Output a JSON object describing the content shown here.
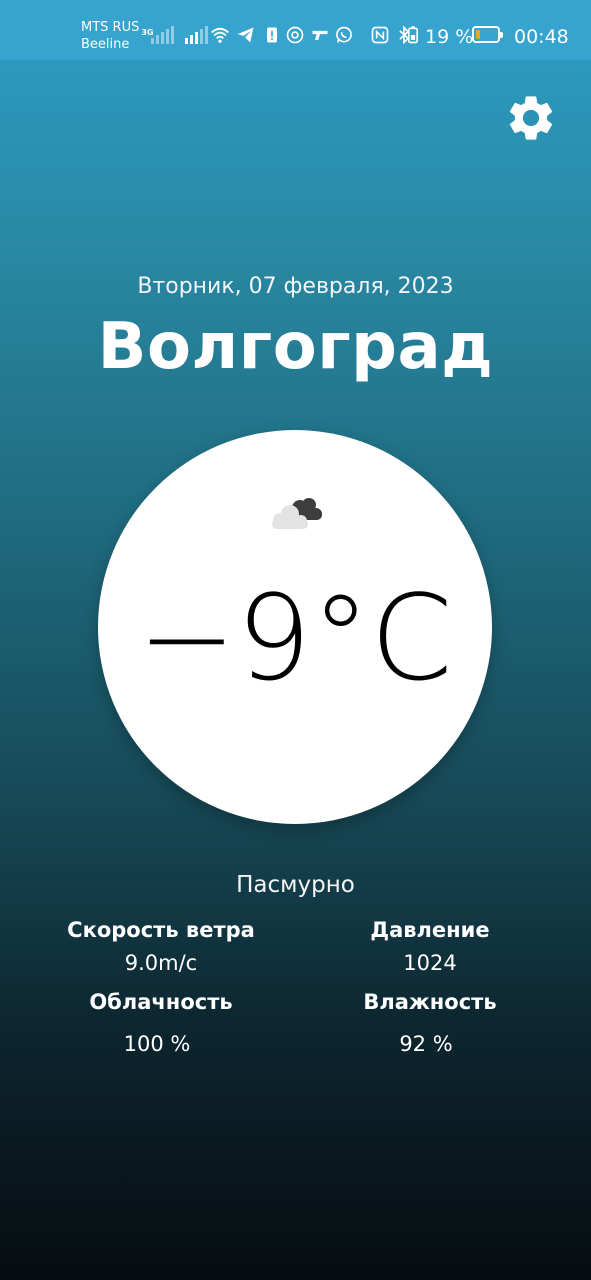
{
  "status_bar": {
    "carrier1": "MTS RUS",
    "carrier1_net": "3G",
    "carrier2": "Beeline",
    "battery_percent": "19 %",
    "battery_level": 0.19,
    "time": "00:48",
    "icons": [
      "signal-icon",
      "signal-icon",
      "wifi-icon",
      "telegram-icon",
      "notification-icon",
      "email-icon",
      "gun-icon",
      "whatsapp-icon",
      "nfc-icon",
      "bluetooth-icon",
      "battery-saver-icon",
      "battery-icon"
    ]
  },
  "header": {
    "date": "Вторник, 07 февраля, 2023",
    "city": "Волгоград"
  },
  "weather": {
    "icon": "cloud-icon",
    "temperature": "−9°C",
    "condition": "Пасмурно"
  },
  "stats": {
    "wind_label": "Скорость ветра",
    "wind_value": "9.0m/c",
    "pressure_label": "Давление",
    "pressure_value": "1024",
    "clouds_label": "Облачность",
    "clouds_value": "100 %",
    "humidity_label": "Влажность",
    "humidity_value": "92 %"
  },
  "colors": {
    "status_bar": "#36a4cf",
    "gradient_top": "#2c9ec6",
    "gradient_bottom": "#060c10",
    "battery_fill": "#f0a22a"
  }
}
